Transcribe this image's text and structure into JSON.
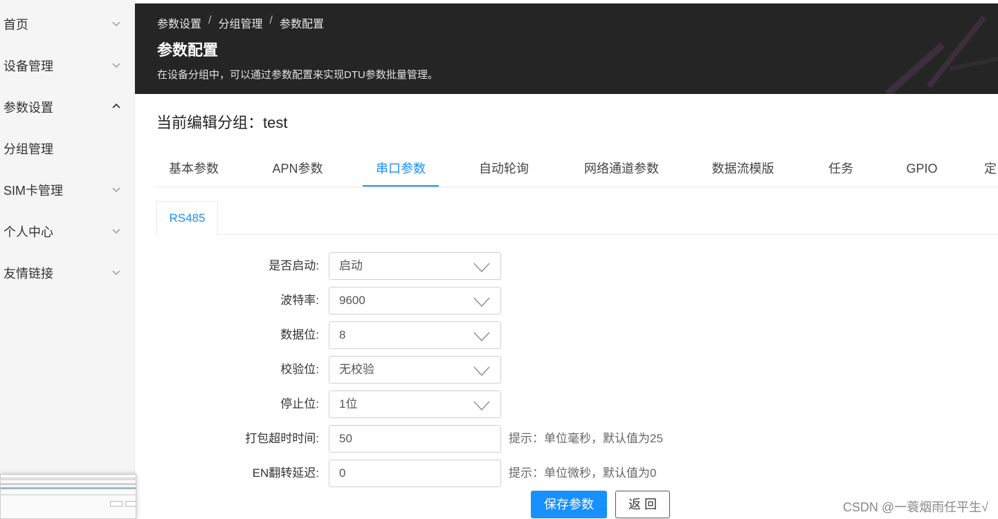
{
  "sidebar": {
    "items": [
      {
        "label": "首页",
        "chevron": "down"
      },
      {
        "label": "设备管理",
        "chevron": "down"
      },
      {
        "label": "参数设置",
        "chevron": "up"
      },
      {
        "label": "分组管理",
        "chevron": ""
      },
      {
        "label": "SIM卡管理",
        "chevron": "down"
      },
      {
        "label": "个人中心",
        "chevron": "down"
      },
      {
        "label": "友情链接",
        "chevron": "down"
      }
    ]
  },
  "header": {
    "breadcrumb": [
      "参数设置",
      "分组管理",
      "参数配置"
    ],
    "breadcrumb_sep": "/",
    "title": "参数配置",
    "description": "在设备分组中，可以通过参数配置来实现DTU参数批量管理。"
  },
  "group": {
    "title": "当前编辑分组：test"
  },
  "tabs": [
    {
      "label": "基本参数",
      "active": false
    },
    {
      "label": "APN参数",
      "active": false
    },
    {
      "label": "串口参数",
      "active": true
    },
    {
      "label": "自动轮询",
      "active": false
    },
    {
      "label": "网络通道参数",
      "active": false
    },
    {
      "label": "数据流模版",
      "active": false
    },
    {
      "label": "任务",
      "active": false
    },
    {
      "label": "GPIO",
      "active": false
    },
    {
      "label": "定",
      "active": false
    }
  ],
  "subtabs": [
    {
      "label": "RS485",
      "active": true
    }
  ],
  "form": {
    "enable": {
      "label": "是否启动:",
      "value": "启动"
    },
    "baud": {
      "label": "波特率:",
      "value": "9600"
    },
    "databits": {
      "label": "数据位:",
      "value": "8"
    },
    "parity": {
      "label": "校验位:",
      "value": "无校验"
    },
    "stopbits": {
      "label": "停止位:",
      "value": "1位"
    },
    "timeout": {
      "label": "打包超时时间:",
      "value": "50",
      "hint": "提示：单位毫秒，默认值为25"
    },
    "en_delay": {
      "label": "EN翻转延迟:",
      "value": "0",
      "hint": "提示：单位微秒，默认值为0"
    }
  },
  "buttons": {
    "save": "保存参数",
    "back": "返 回"
  },
  "watermark": "CSDN @一蓑烟雨任平生√",
  "colors": {
    "accent": "#1890ff",
    "header_bg": "#252525",
    "sidebar_bg": "#f5f5f5"
  }
}
